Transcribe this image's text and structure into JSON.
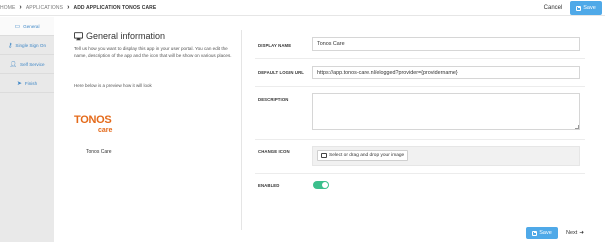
{
  "breadcrumb": [
    "Home",
    "Applications",
    "Add Application Tonos Care"
  ],
  "header": {
    "cancel_label": "Cancel",
    "save_label": "Save"
  },
  "sidebar": {
    "items": [
      {
        "label": "General",
        "icon": "monitor-icon",
        "active": true
      },
      {
        "label": "Single Sign On",
        "icon": "key-icon",
        "active": false
      },
      {
        "label": "Self Service",
        "icon": "user-icon",
        "active": false
      },
      {
        "label": "Finish",
        "icon": "paper-plane-icon",
        "active": false
      }
    ]
  },
  "info": {
    "title": "General information",
    "description": "Tell us how you want to display this app in your user portal. You can edit the name, description of the app and the icon that will be show on various places.",
    "preview_hint": "Here below is a preview how it will look",
    "logo_text_top": "TONOS",
    "logo_text_bottom": "care",
    "preview_name": "Tonos Care"
  },
  "form": {
    "display_name_label": "Display name",
    "display_name_value": "Tonos Care",
    "login_url_label": "Default login url",
    "login_url_value": "https://app.tonos-care.nl/elogged?provider={providername}",
    "description_label": "Description",
    "description_value": "",
    "icon_label": "Change icon",
    "upload_label": "Select or drag and drop your image",
    "enabled_label": "Enabled",
    "enabled": true
  },
  "footer": {
    "save_label": "Save",
    "next_label": "Next"
  },
  "colors": {
    "accent": "#4fa9e8",
    "toggle_on": "#3bbf8c",
    "brand": "#e46a1a",
    "sidebar_bg": "#e9e9e9"
  }
}
